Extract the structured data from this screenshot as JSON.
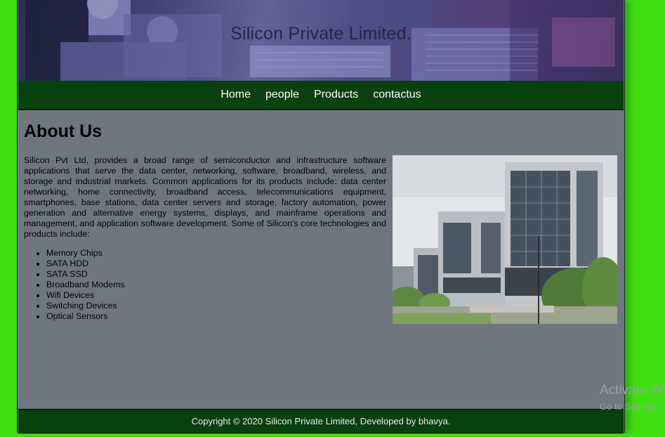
{
  "header": {
    "title": "Silicon Private Limited."
  },
  "nav": {
    "items": [
      "Home",
      "people",
      "Products",
      "contactus"
    ]
  },
  "main": {
    "heading": "About Us",
    "paragraph": "Silicon Pvt Ltd, provides a broad range of semiconductor and infrastructure software applications that serve the data center, networking, software, broadband, wireless, and storage and industrial markets. Common applications for its products include: data center networking, home connectivity, broadband access, telecommunications equipment, smartphones, base stations, data center servers and storage, factory automation, power generation and alternative energy systems, displays, and mainframe operations and management, and application software development. Some of Silicon's core technologies and products include:",
    "products": [
      "Memory Chips",
      "SATA HDD",
      "SATA SSD",
      "Broadband Modems",
      "Wifi Devices",
      "Switching Devices",
      "Optical Sensors"
    ]
  },
  "footer": {
    "text": "Copyright © 2020 Silicon Private Limited, Developed by bhavya."
  },
  "os_overlay": {
    "line1": "Activate W",
    "line2": "Go to Settings"
  },
  "colors": {
    "background": "#3ee10f",
    "nav": "#07410b",
    "content": "#707680",
    "footer": "#07410b"
  }
}
